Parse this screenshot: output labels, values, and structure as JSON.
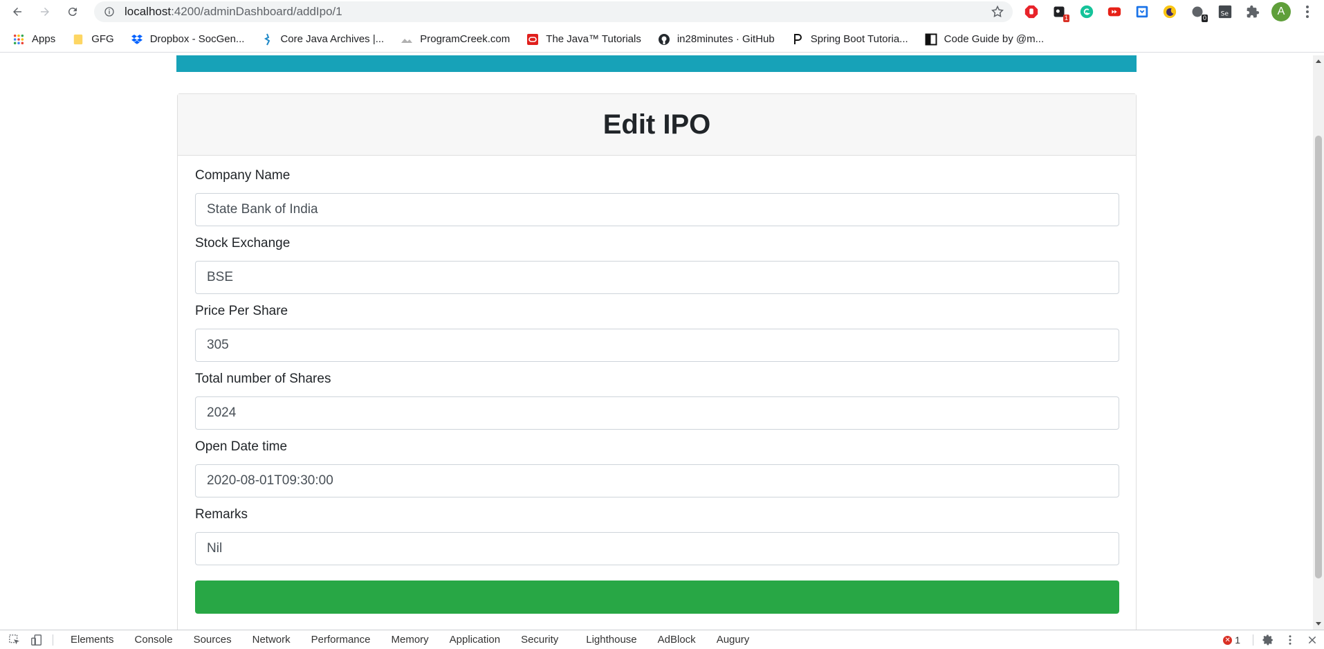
{
  "browser": {
    "url_host": "localhost",
    "url_rest": ":4200/adminDashboard/addIpo/1",
    "ext_badge_1": "1",
    "ext_badge_2": "0",
    "avatar_letter": "A"
  },
  "bookmarks": [
    {
      "label": "Apps"
    },
    {
      "label": "GFG"
    },
    {
      "label": "Dropbox - SocGen..."
    },
    {
      "label": "Core Java Archives |..."
    },
    {
      "label": "ProgramCreek.com"
    },
    {
      "label": "The Java™ Tutorials"
    },
    {
      "label": "in28minutes · GitHub"
    },
    {
      "label": "Spring Boot Tutoria..."
    },
    {
      "label": "Code Guide by @m..."
    }
  ],
  "form": {
    "title": "Edit IPO",
    "fields": [
      {
        "label": "Company Name",
        "value": "State Bank of India"
      },
      {
        "label": "Stock Exchange",
        "value": "BSE"
      },
      {
        "label": "Price Per Share",
        "value": "305"
      },
      {
        "label": "Total number of Shares",
        "value": "2024"
      },
      {
        "label": "Open Date time",
        "value": "2020-08-01T09:30:00"
      },
      {
        "label": "Remarks",
        "value": "Nil"
      }
    ]
  },
  "devtools": {
    "tabs": [
      "Elements",
      "Console",
      "Sources",
      "Network",
      "Performance",
      "Memory",
      "Application",
      "Security",
      "Lighthouse",
      "AdBlock",
      "Augury"
    ],
    "error_count": "1"
  },
  "colors": {
    "navbar": "#17a2b8",
    "submit": "#28a745"
  }
}
